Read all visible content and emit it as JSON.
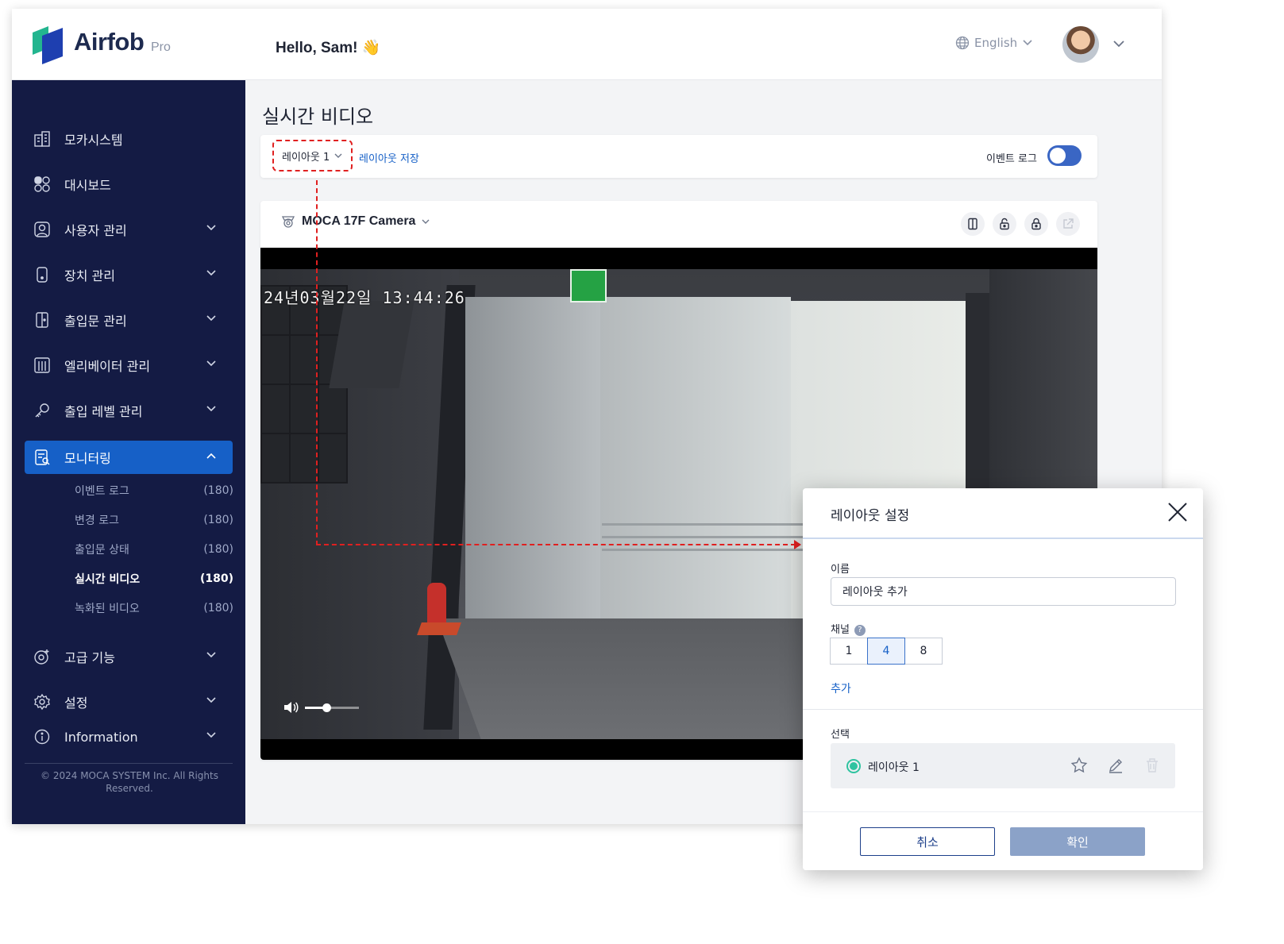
{
  "header": {
    "brand": "Airfob",
    "brand_sub": "Pro",
    "greeting": "Hello, Sam! 👋",
    "language": "English"
  },
  "sidebar": {
    "items": [
      {
        "label": "모카시스템",
        "icon": "building-icon"
      },
      {
        "label": "대시보드",
        "icon": "dashboard-icon"
      },
      {
        "label": "사용자 관리",
        "icon": "user-icon"
      },
      {
        "label": "장치 관리",
        "icon": "device-icon"
      },
      {
        "label": "출입문 관리",
        "icon": "door-icon"
      },
      {
        "label": "엘리베이터 관리",
        "icon": "elevator-icon"
      },
      {
        "label": "출입 레벨 관리",
        "icon": "key-icon"
      },
      {
        "label": "모니터링",
        "icon": "monitor-icon"
      },
      {
        "label": "고급 기능",
        "icon": "advanced-icon"
      },
      {
        "label": "설정",
        "icon": "gear-icon"
      },
      {
        "label": "Information",
        "icon": "info-icon"
      }
    ],
    "submenu": [
      {
        "label": "이벤트 로그",
        "count": "(180)"
      },
      {
        "label": "변경 로그",
        "count": "(180)"
      },
      {
        "label": "출입문 상태",
        "count": "(180)"
      },
      {
        "label": "실시간 비디오",
        "count": "(180)"
      },
      {
        "label": "녹화된 비디오",
        "count": "(180)"
      }
    ],
    "copyright": "© 2024 MOCA SYSTEM Inc. All Rights Reserved."
  },
  "main": {
    "title": "실시간 비디오",
    "layout_select": "레이아웃 1",
    "save_layout": "레이아웃 저장",
    "event_log_label": "이벤트 로그",
    "camera_name": "MOCA 17F Camera",
    "timestamp": "24년03월22일 13:44:26",
    "volume": 0.4
  },
  "dialog": {
    "title": "레이아웃 설정",
    "name_label": "이름",
    "name_value": "레이아웃 추가",
    "channel_label": "채널",
    "channels": [
      "1",
      "4",
      "8"
    ],
    "selected_channel": "4",
    "add_link": "추가",
    "select_label": "선택",
    "selected_layout": "레이아웃 1",
    "cancel": "취소",
    "confirm": "확인"
  },
  "colors": {
    "sidebar_bg": "#141b44",
    "accent": "#1660c7",
    "guide": "#e02020",
    "radio": "#2fc3a0"
  }
}
